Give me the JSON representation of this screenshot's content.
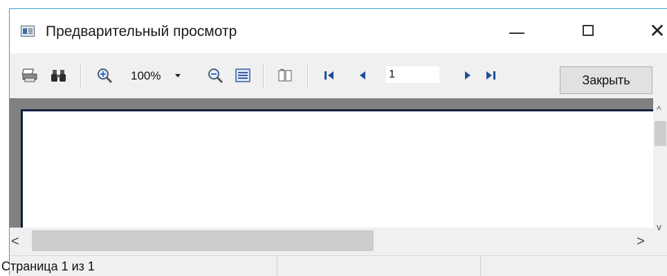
{
  "window": {
    "title": "Предварительный просмотр",
    "accent": "#2aa6c9"
  },
  "toolbar": {
    "print_icon": "printer-icon",
    "find_icon": "binoculars-icon",
    "zoom_in_icon": "zoom-in-icon",
    "zoom_value": "100%",
    "zoom_out_icon": "zoom-out-icon",
    "page_view_icon": "page-view-icon",
    "book_icon": "book-icon",
    "first_icon": "first-page-icon",
    "prev_icon": "prev-page-icon",
    "page_value": "1",
    "next_icon": "next-page-icon",
    "last_icon": "last-page-icon",
    "close_label": "Закрыть"
  },
  "scrollbars": {
    "up": "^",
    "down": "v",
    "left": "<",
    "right": ">"
  },
  "status": {
    "page_info": "Страница 1 из 1",
    "panel2": "",
    "panel3": ""
  }
}
